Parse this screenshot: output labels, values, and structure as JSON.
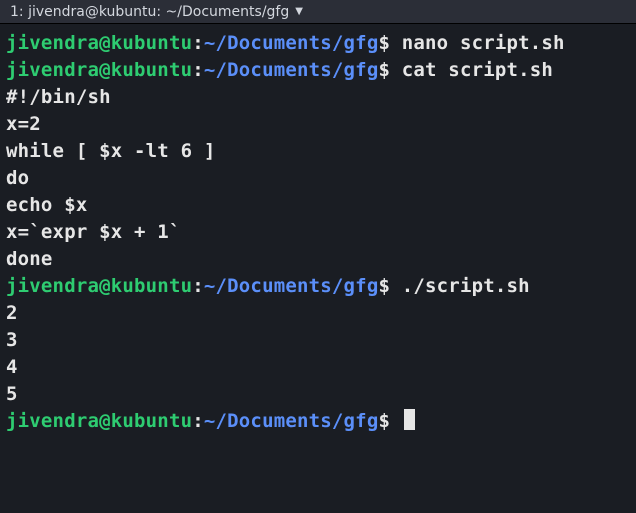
{
  "titlebar": {
    "label": "1: jivendra@kubuntu: ~/Documents/gfg"
  },
  "prompt": {
    "user": "jivendra@kubuntu",
    "sep": ":",
    "path": "~/Documents/gfg",
    "sigil": "$"
  },
  "lines": [
    {
      "type": "prompt",
      "cmd": "nano script.sh"
    },
    {
      "type": "prompt",
      "cmd": "cat script.sh"
    },
    {
      "type": "out",
      "text": "#!/bin/sh"
    },
    {
      "type": "out",
      "text": "x=2"
    },
    {
      "type": "out",
      "text": "while [ $x -lt 6 ]"
    },
    {
      "type": "out",
      "text": "do"
    },
    {
      "type": "out",
      "text": "echo $x"
    },
    {
      "type": "out",
      "text": "x=`expr $x + 1`"
    },
    {
      "type": "out",
      "text": "done"
    },
    {
      "type": "prompt",
      "cmd": "./script.sh"
    },
    {
      "type": "out",
      "text": "2"
    },
    {
      "type": "out",
      "text": "3"
    },
    {
      "type": "out",
      "text": "4"
    },
    {
      "type": "out",
      "text": "5"
    },
    {
      "type": "prompt",
      "cmd": "",
      "cursor": true
    }
  ]
}
